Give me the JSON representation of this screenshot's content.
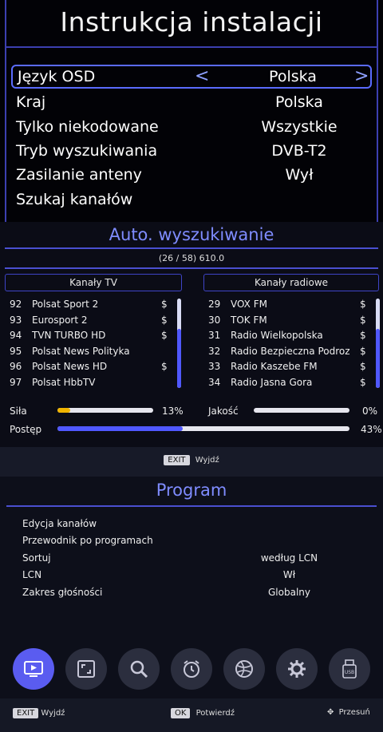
{
  "install": {
    "title": "Instrukcja instalacji",
    "rows": [
      {
        "label": "Język OSD",
        "value": "Polska"
      },
      {
        "label": "Kraj",
        "value": "Polska"
      },
      {
        "label": "Tylko niekodowane",
        "value": "Wszystkie"
      },
      {
        "label": "Tryb wyszukiwania",
        "value": "DVB-T2"
      },
      {
        "label": "Zasilanie anteny",
        "value": "Wył"
      },
      {
        "label": "Szukaj kanałów",
        "value": ""
      }
    ],
    "arrow_left": "<",
    "arrow_right": ">"
  },
  "scan": {
    "title": "Auto. wyszukiwanie",
    "progress_text": "(26 / 58)  610.0",
    "tv_header": "Kanały TV",
    "radio_header": "Kanały radiowe",
    "tv_channels": [
      {
        "num": "92",
        "name": "Polsat Sport 2",
        "flag": "$"
      },
      {
        "num": "93",
        "name": "Eurosport 2",
        "flag": "$"
      },
      {
        "num": "94",
        "name": "TVN TURBO HD",
        "flag": "$"
      },
      {
        "num": "95",
        "name": "Polsat News Polityka",
        "flag": ""
      },
      {
        "num": "96",
        "name": "Polsat News HD",
        "flag": "$"
      },
      {
        "num": "97",
        "name": "Polsat  HbbTV",
        "flag": ""
      }
    ],
    "radio_channels": [
      {
        "num": "29",
        "name": "VOX FM",
        "flag": "$"
      },
      {
        "num": "30",
        "name": "TOK FM",
        "flag": "$"
      },
      {
        "num": "31",
        "name": "Radio Wielkopolska",
        "flag": "$"
      },
      {
        "num": "32",
        "name": "Radio Bezpieczna Podroz",
        "flag": "$"
      },
      {
        "num": "33",
        "name": "Radio Kaszebe FM",
        "flag": "$"
      },
      {
        "num": "34",
        "name": "Radio Jasna Gora",
        "flag": "$"
      }
    ],
    "strength_label": "Siła",
    "strength_value": "13%",
    "strength_pct": 13,
    "quality_label": "Jakość",
    "quality_value": "0%",
    "quality_pct": 0,
    "progress_label": "Postęp",
    "progress_value": "43%",
    "progress_pct": 43
  },
  "scan_footer": {
    "key": "EXIT",
    "label": "Wyjdź"
  },
  "program": {
    "title": "Program",
    "items": [
      {
        "label": "Edycja kanałów",
        "value": ""
      },
      {
        "label": "Przewodnik po programach",
        "value": ""
      },
      {
        "label": "Sortuj",
        "value": "według LCN"
      },
      {
        "label": "LCN",
        "value": "Wł"
      },
      {
        "label": "Zakres głośności",
        "value": "Globalny"
      }
    ]
  },
  "icons": [
    "tv-icon",
    "picture-icon",
    "search-icon",
    "clock-icon",
    "globe-icon",
    "gear-icon",
    "usb-icon"
  ],
  "footer": {
    "exit_key": "EXIT",
    "exit_label": "Wyjdź",
    "ok_key": "OK",
    "ok_label": "Potwierdź",
    "move_label": "Przesuń"
  },
  "colors": {
    "accent": "#5a5cf0",
    "title_blue": "#7f8cff",
    "strength": "#f0b400"
  }
}
